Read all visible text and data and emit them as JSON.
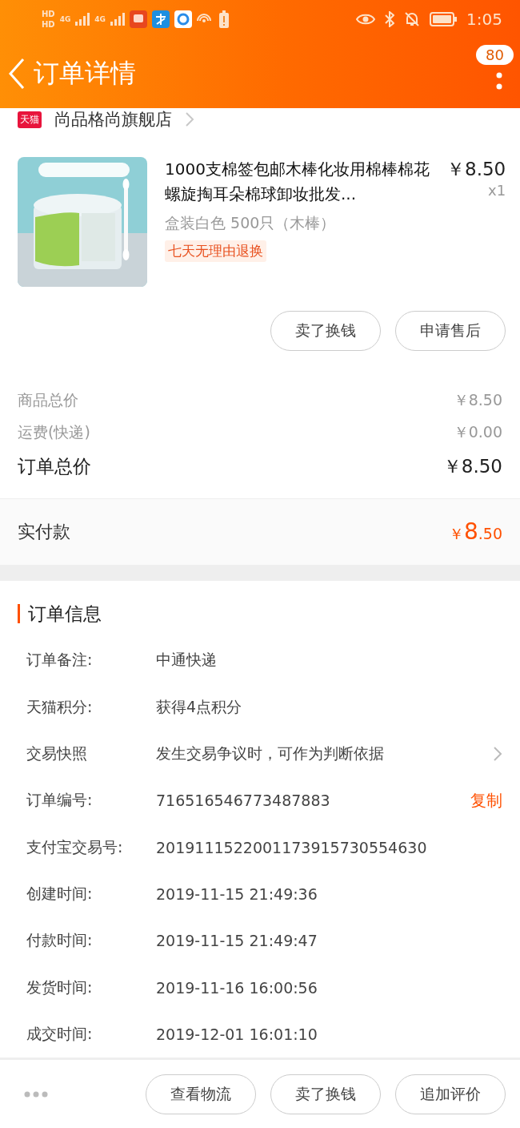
{
  "status_bar": {
    "sim_labels": [
      "HD",
      "HD"
    ],
    "network_labels": [
      "4G",
      "4G"
    ],
    "time": "1:05"
  },
  "header": {
    "title": "订单详情",
    "badge": "80"
  },
  "store": {
    "badge": "天猫",
    "name": "尚品格尚旗舰店"
  },
  "product": {
    "title": "1000支棉签包邮木棒化妆用棉棒棉花螺旋掏耳朵棉球卸妆批发...",
    "price": "￥8.50",
    "quantity": "x1",
    "variant": "盒装白色 500只（木棒）",
    "tag": "七天无理由退换",
    "actions": [
      "卖了换钱",
      "申请售后"
    ]
  },
  "summary": [
    {
      "label": "商品总价",
      "value": "￥8.50",
      "kind": "minor"
    },
    {
      "label": "运费(快递)",
      "value": "￥0.00",
      "kind": "minor"
    },
    {
      "label": "订单总价",
      "value": "￥8.50",
      "kind": "major"
    }
  ],
  "paid": {
    "label": "实付款",
    "currency": "￥",
    "integer": "8",
    "decimal": ".50"
  },
  "order_info": {
    "title": "订单信息",
    "rows": [
      {
        "label": "订单备注:",
        "value": "中通快递",
        "kind": "plain"
      },
      {
        "label": "天猫积分:",
        "value": "获得4点积分",
        "kind": "plain"
      },
      {
        "label": "交易快照",
        "value": "发生交易争议时，可作为判断依据",
        "kind": "link"
      },
      {
        "label": "订单编号:",
        "value": "716516546773487883",
        "kind": "copy",
        "action": "复制"
      },
      {
        "label": "支付宝交易号:",
        "value": "2019111522001173915730554630",
        "kind": "plain"
      },
      {
        "label": "创建时间:",
        "value": "2019-11-15 21:49:36",
        "kind": "plain"
      },
      {
        "label": "付款时间:",
        "value": "2019-11-15 21:49:47",
        "kind": "plain"
      },
      {
        "label": "发货时间:",
        "value": "2019-11-16 16:00:56",
        "kind": "plain"
      },
      {
        "label": "成交时间:",
        "value": "2019-12-01 16:01:10",
        "kind": "plain"
      }
    ]
  },
  "bottom_bar": {
    "buttons": [
      "查看物流",
      "卖了换钱",
      "追加评价"
    ]
  }
}
